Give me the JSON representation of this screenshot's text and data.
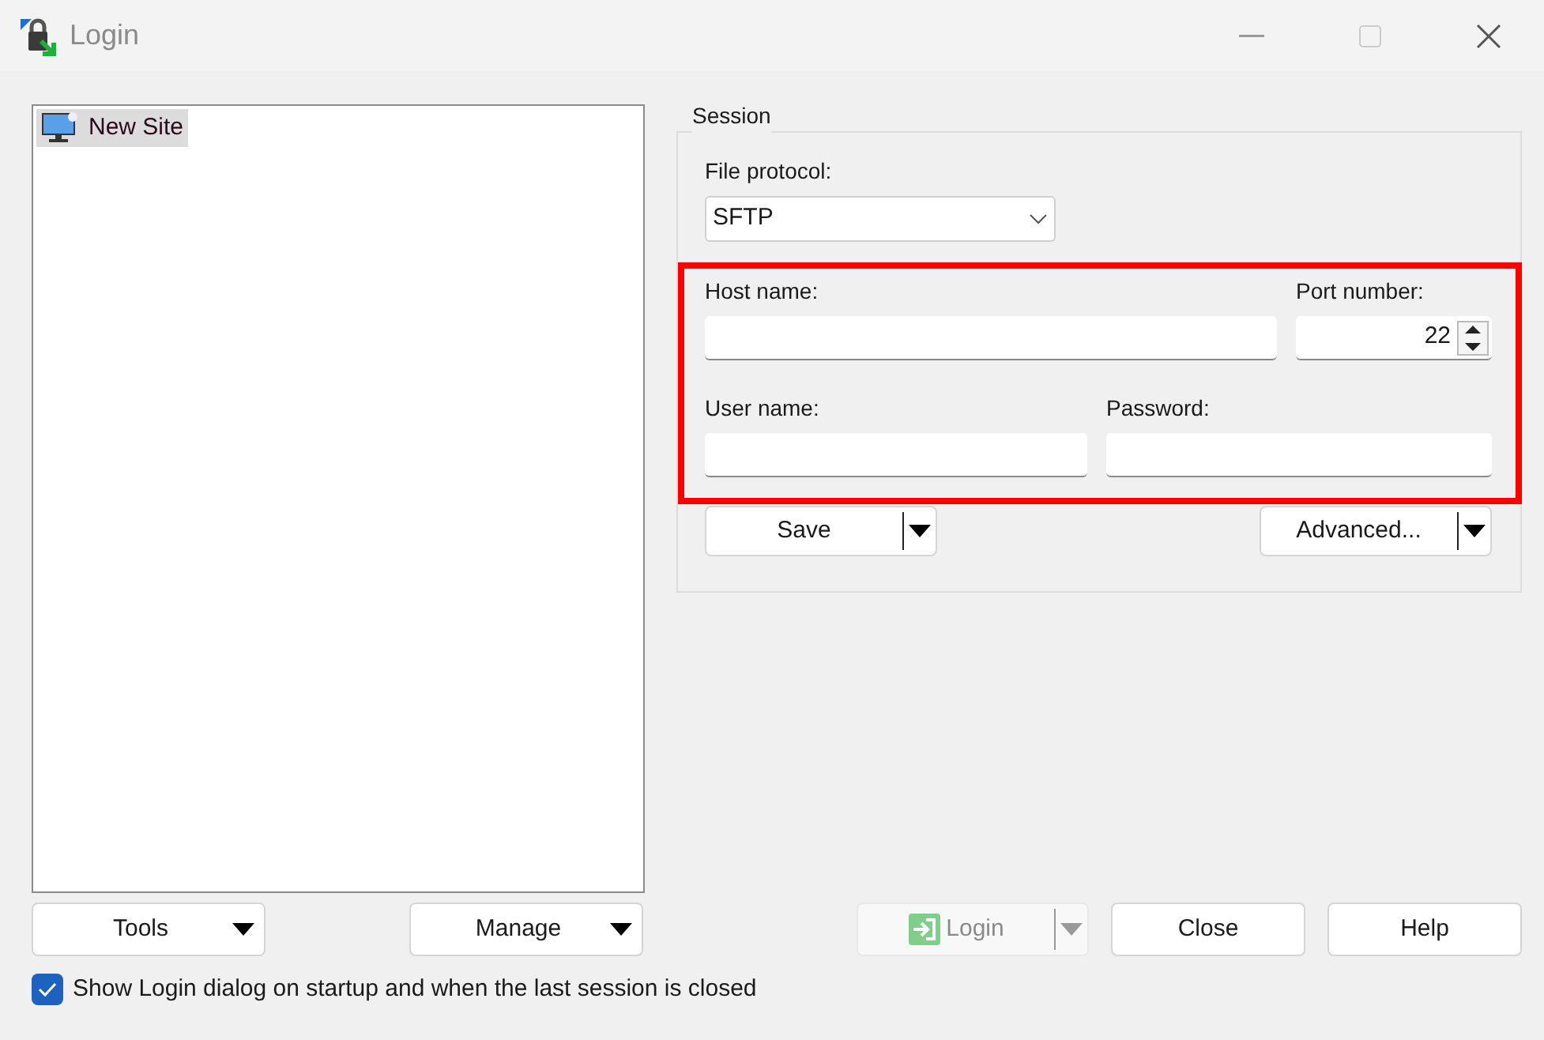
{
  "window": {
    "title": "Login"
  },
  "sites": [
    {
      "label": "New Site",
      "selected": true
    }
  ],
  "session": {
    "title": "Session",
    "file_protocol": {
      "label": "File protocol:",
      "value": "SFTP"
    },
    "host_name": {
      "label": "Host name:"
    },
    "port_number": {
      "label": "Port number:",
      "value": "22"
    },
    "user_name": {
      "label": "User name:"
    },
    "password": {
      "label": "Password:"
    },
    "buttons": [
      {
        "label": "Save"
      },
      {
        "label": "Advanced..."
      }
    ]
  },
  "left_buttons": [
    {
      "label": "Tools"
    },
    {
      "label": "Manage"
    }
  ],
  "dialog_buttons": [
    {
      "label": "Login",
      "kind": "split",
      "disabled": true
    },
    {
      "label": "Close",
      "kind": "plain",
      "disabled": false
    },
    {
      "label": "Help",
      "kind": "plain",
      "disabled": false
    }
  ],
  "startup_option": {
    "label": "Show Login dialog on startup and when the last session is closed",
    "checked": true
  }
}
